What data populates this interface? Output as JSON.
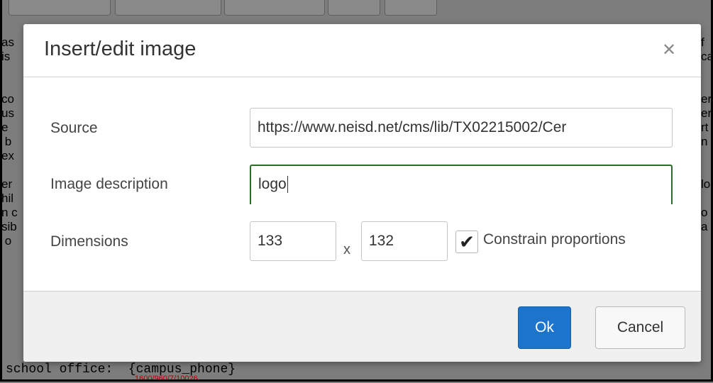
{
  "background": {
    "left_lines": [
      "as",
      "is",
      "",
      "",
      "co",
      "us",
      "e",
      " b",
      "ex",
      "",
      "er",
      "hil",
      "n c",
      "sib",
      " o"
    ],
    "right_lines": [
      "f",
      "ca",
      "",
      "",
      "er",
      "er",
      "rt",
      "n",
      "",
      "",
      "lo",
      "",
      "o",
      "a",
      ""
    ],
    "bottom_text": "school office:  {campus_phone}",
    "bottom_red_text": "1600/960/7/10026"
  },
  "dialog": {
    "title": "Insert/edit image",
    "close_icon": "close-icon",
    "source": {
      "label": "Source",
      "value": "https://www.neisd.net/cms/lib/TX02215002/Cer"
    },
    "description": {
      "label": "Image description",
      "value": "logo"
    },
    "dimensions": {
      "label": "Dimensions",
      "width": "133",
      "separator": "x",
      "height": "132",
      "constrain_checked": true,
      "constrain_label": "Constrain proportions"
    },
    "ok_label": "Ok",
    "cancel_label": "Cancel"
  },
  "colors": {
    "accent": "#1c74cc",
    "focus_border": "#2d6b2d",
    "overlay": "#7d7d7d"
  }
}
